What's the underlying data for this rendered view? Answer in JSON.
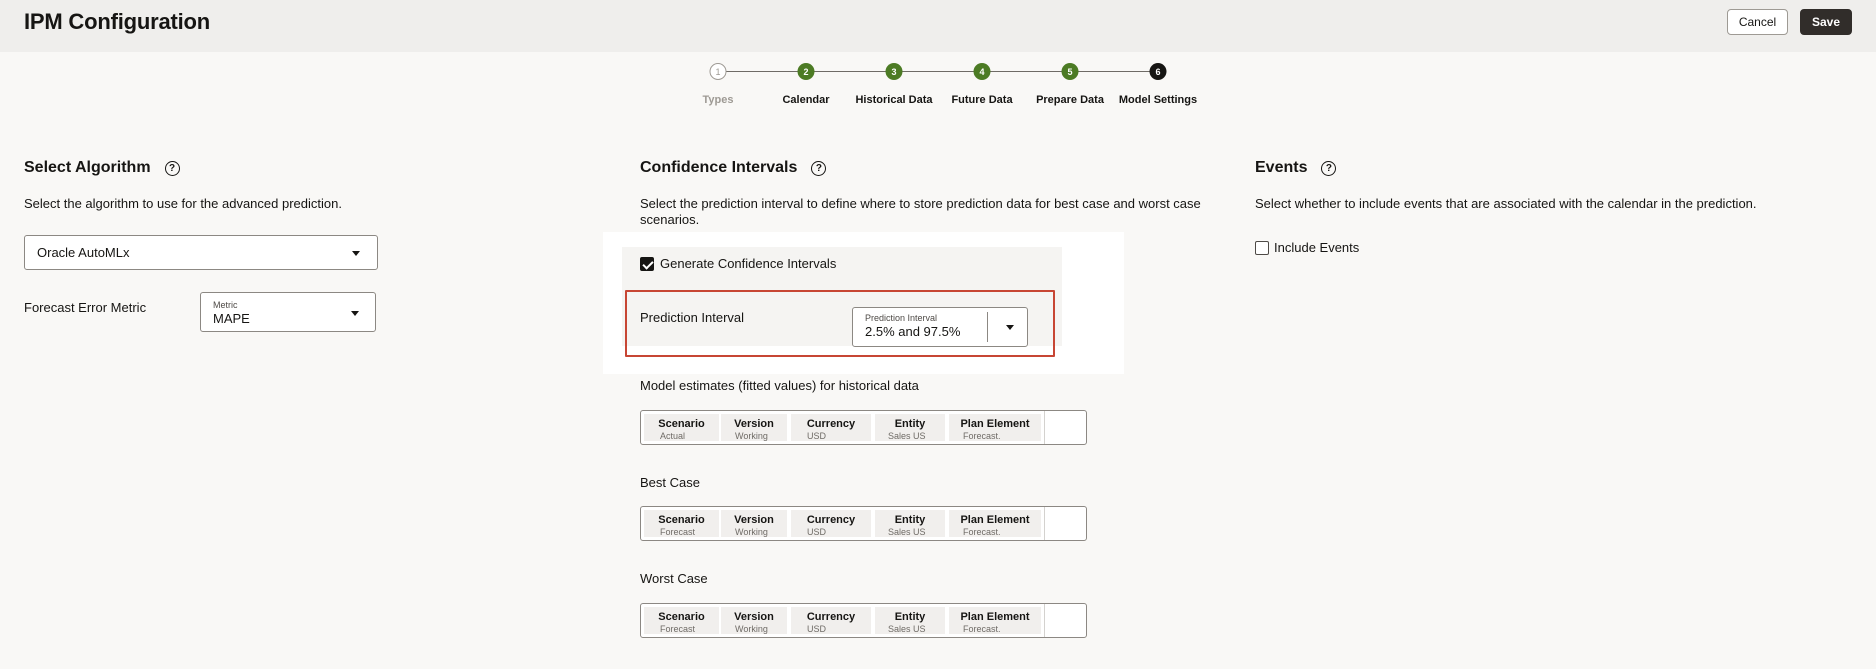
{
  "header": {
    "title": "IPM Configuration",
    "cancel_label": "Cancel",
    "save_label": "Save"
  },
  "stepper": {
    "steps": [
      {
        "number": "1",
        "label": "Types",
        "state": "todo"
      },
      {
        "number": "2",
        "label": "Calendar",
        "state": "done"
      },
      {
        "number": "3",
        "label": "Historical Data",
        "state": "done"
      },
      {
        "number": "4",
        "label": "Future Data",
        "state": "done"
      },
      {
        "number": "5",
        "label": "Prepare Data",
        "state": "done"
      },
      {
        "number": "6",
        "label": "Model Settings",
        "state": "current"
      }
    ]
  },
  "algorithm": {
    "title": "Select Algorithm",
    "description": "Select the algorithm to use for the advanced prediction.",
    "selected": "Oracle AutoMLx",
    "metric_field_label": "Forecast Error Metric",
    "metric_select_label": "Metric",
    "metric_value": "MAPE"
  },
  "confidence": {
    "title": "Confidence Intervals",
    "description_line1": "Select the prediction interval to define where to store prediction data for best case and worst case",
    "description_line2": "scenarios.",
    "generate_label": "Generate Confidence Intervals",
    "generate_checked": true,
    "interval_field_label": "Prediction Interval",
    "interval_select_label": "Prediction Interval",
    "interval_value": "2.5% and 97.5%",
    "fitted_label": "Model estimates (fitted values) for historical data",
    "best_label": "Best Case",
    "worst_label": "Worst Case",
    "pov_fitted": [
      {
        "name": "Scenario",
        "value": "Actual"
      },
      {
        "name": "Version",
        "value": "Working"
      },
      {
        "name": "Currency",
        "value": "USD"
      },
      {
        "name": "Entity",
        "value": "Sales US"
      },
      {
        "name": "Plan Element",
        "value": "Forecast."
      }
    ],
    "pov_best": [
      {
        "name": "Scenario",
        "value": "Forecast"
      },
      {
        "name": "Version",
        "value": "Working"
      },
      {
        "name": "Currency",
        "value": "USD"
      },
      {
        "name": "Entity",
        "value": "Sales US"
      },
      {
        "name": "Plan Element",
        "value": "Forecast."
      }
    ],
    "pov_worst": [
      {
        "name": "Scenario",
        "value": "Forecast"
      },
      {
        "name": "Version",
        "value": "Working"
      },
      {
        "name": "Currency",
        "value": "USD"
      },
      {
        "name": "Entity",
        "value": "Sales US"
      },
      {
        "name": "Plan Element",
        "value": "Forecast."
      }
    ]
  },
  "events": {
    "title": "Events",
    "description": "Select whether to include events that are associated with the calendar in the prediction.",
    "include_label": "Include Events",
    "include_checked": false
  },
  "colors": {
    "step_done": "#4c7b24",
    "step_current": "#161513",
    "highlight": "#c74634",
    "save_button": "#312d2a"
  }
}
